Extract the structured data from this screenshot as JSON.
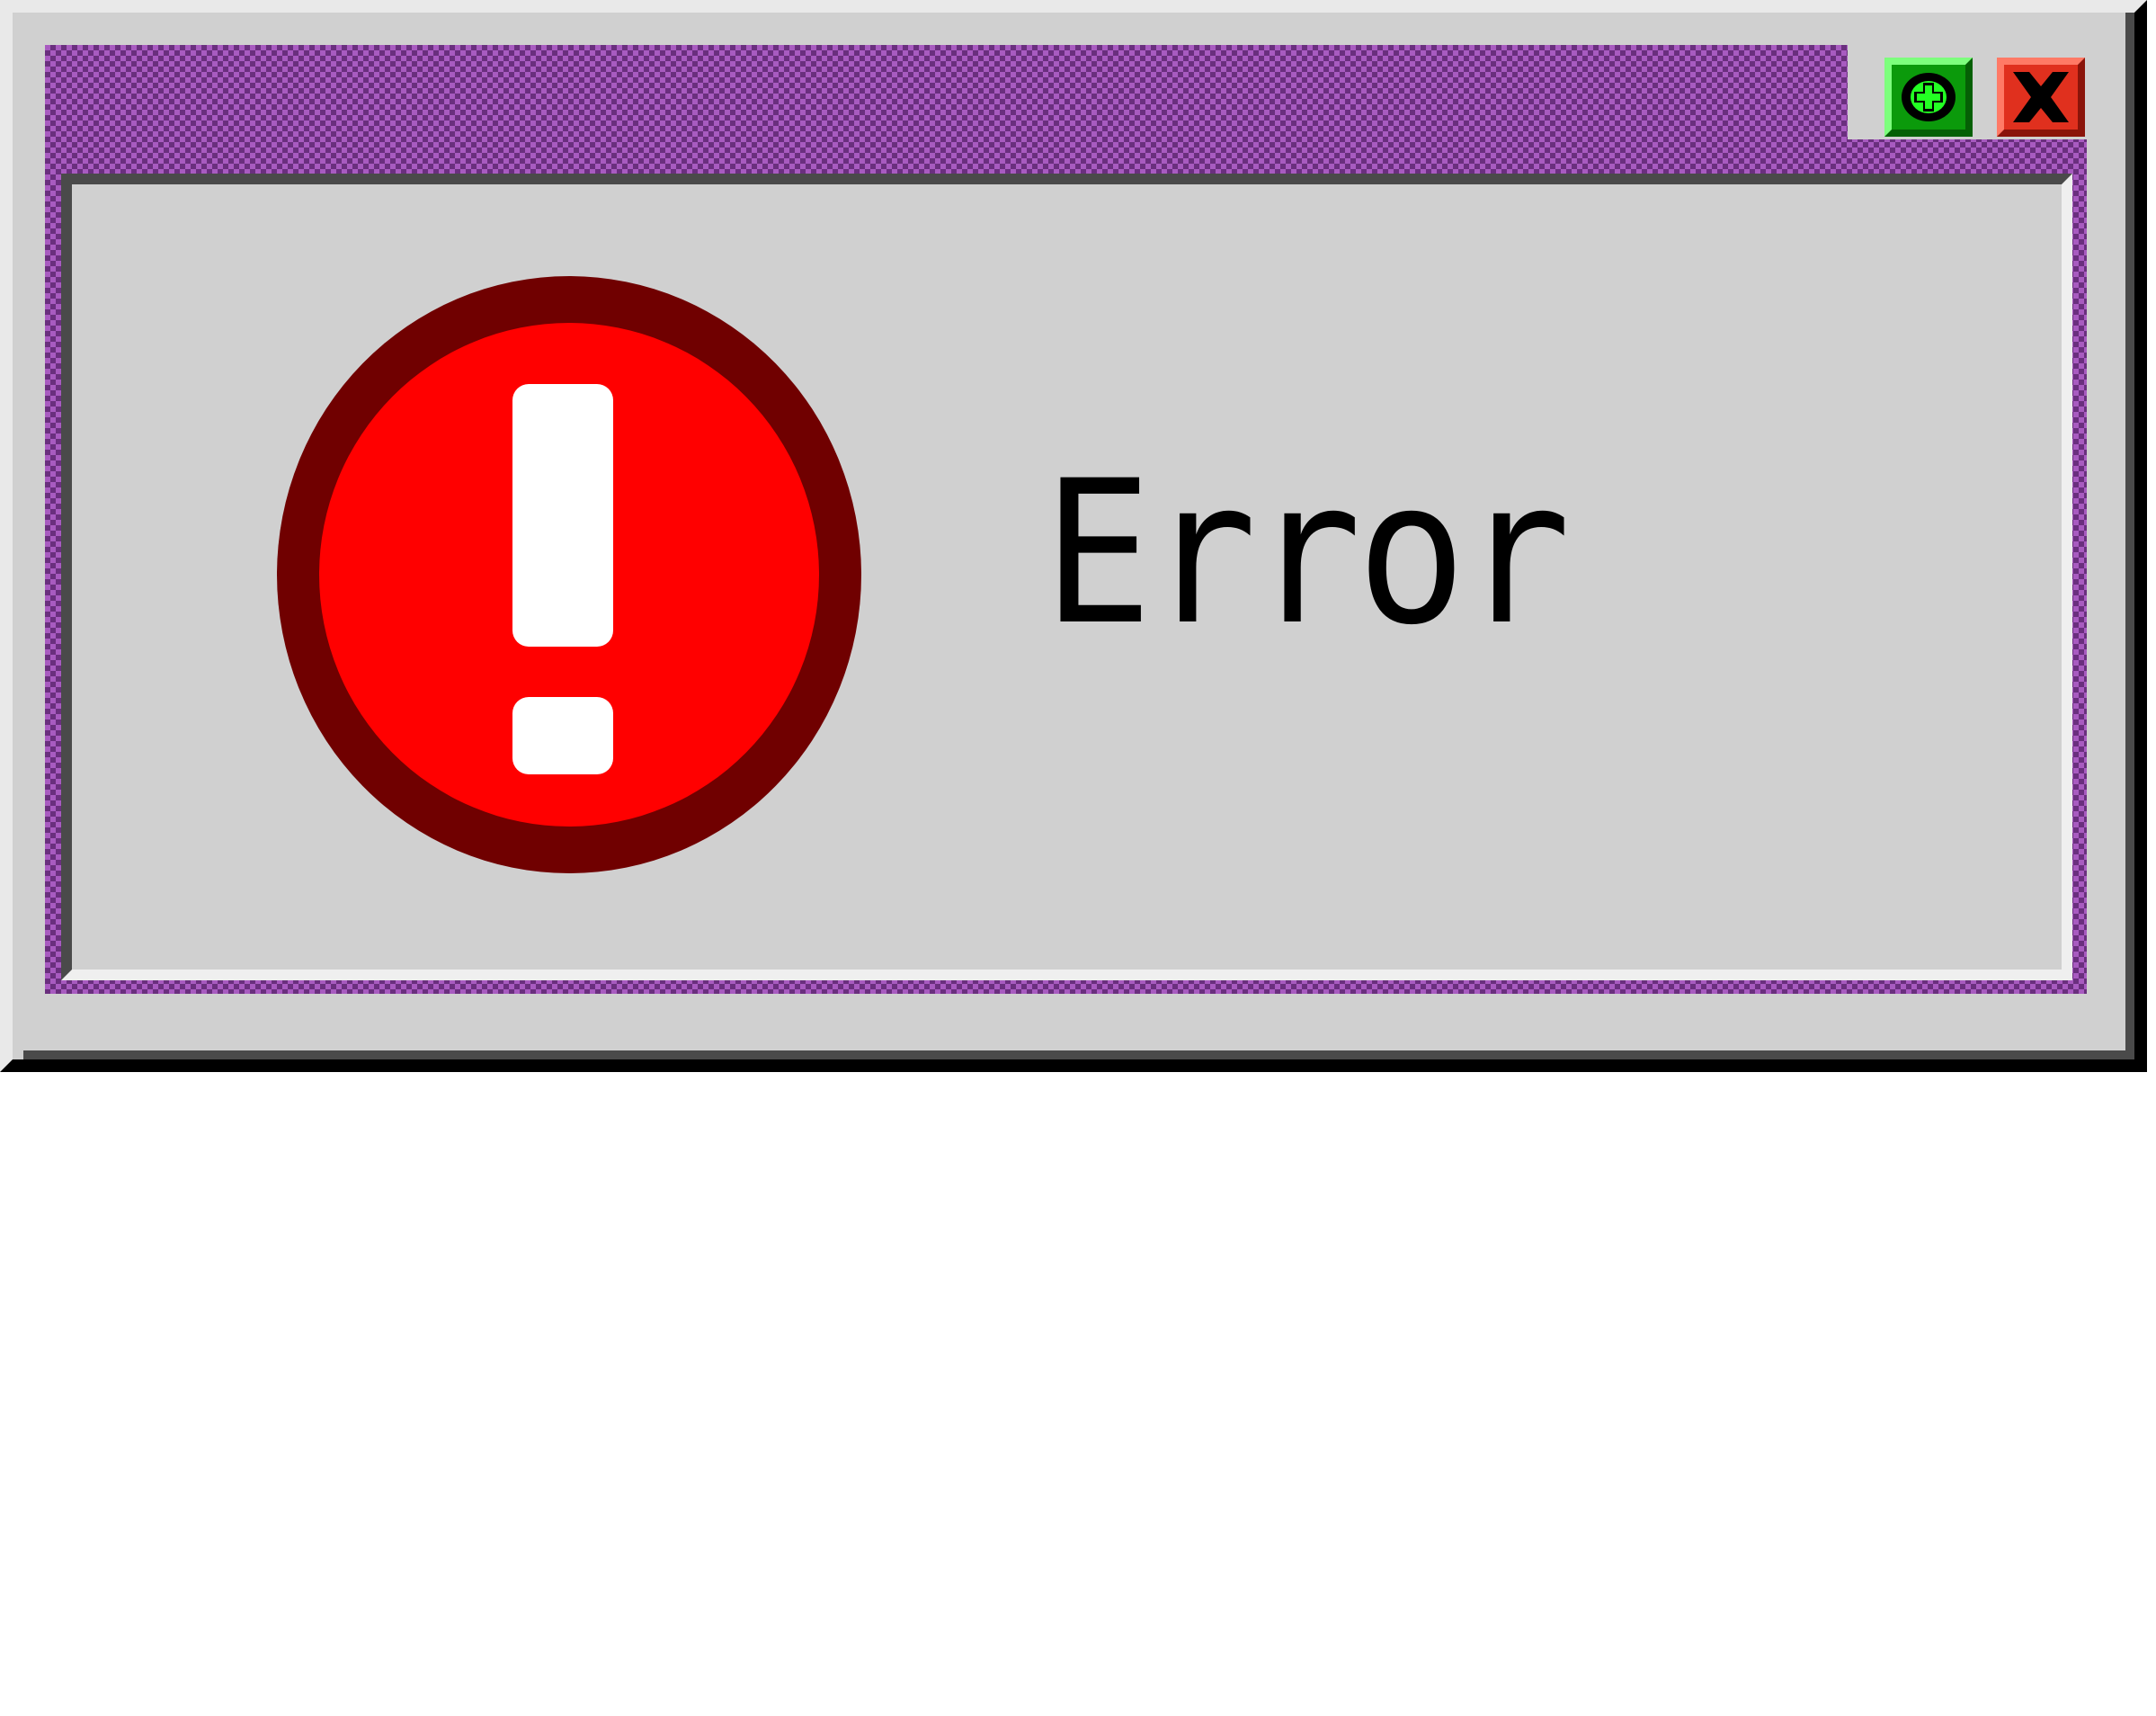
{
  "dialog": {
    "message": "Error",
    "icon": "error-exclamation-icon",
    "colors": {
      "frame_light": "#a85bc0",
      "frame_dark": "#6a2f7e",
      "body": "#d0d0d0",
      "icon_red": "#ff0000",
      "icon_ring": "#700000",
      "minimize_button": "#0b9a0b",
      "close_button": "#e0301e"
    }
  },
  "titlebar": {
    "minimize_icon": "plus-circle-icon",
    "close_icon": "close-x-icon"
  }
}
